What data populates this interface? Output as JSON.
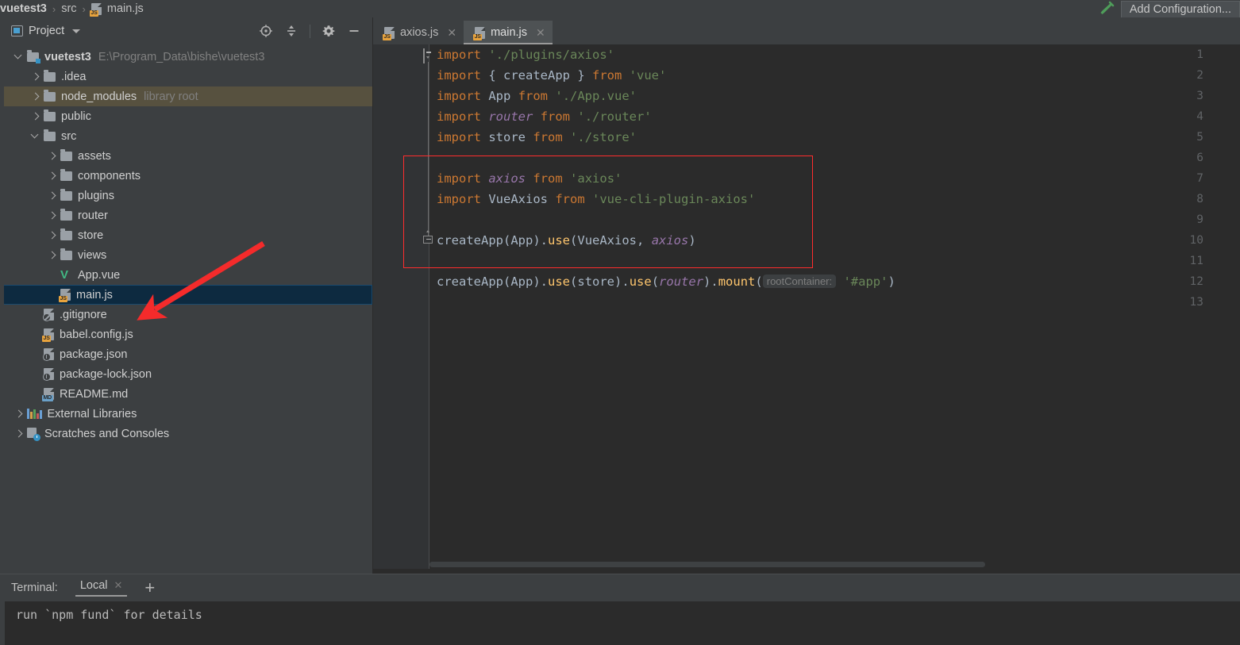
{
  "window": {
    "app": "WebStorm",
    "breadcrumb": [
      {
        "label": "vuetest3",
        "icon": "folder-icon",
        "bold": true
      },
      {
        "label": "src",
        "icon": "folder-icon",
        "bold": false
      },
      {
        "label": "main.js",
        "icon": "js-file-icon",
        "bold": false
      }
    ],
    "breadcrumb_separator": "›",
    "add_configuration_label": "Add Configuration...",
    "build_icon": "hammer-icon"
  },
  "project_panel": {
    "title": "Project",
    "title_icon": "project-view-icon",
    "dropdown_icon": "chevron-down-icon",
    "tools": [
      {
        "name": "locate-icon",
        "tooltip": "Select Opened File"
      },
      {
        "name": "collapse-all-icon",
        "tooltip": "Collapse All"
      },
      {
        "name": "gear-icon",
        "tooltip": "Settings"
      },
      {
        "name": "minimize-icon",
        "tooltip": "Hide"
      }
    ],
    "tree": [
      {
        "label": "vuetest3",
        "sub": "E:\\Program_Data\\bishe\\vuetest3",
        "indent": 0,
        "arrow": "down",
        "icon": "folder-module-icon",
        "bold": true,
        "state": "none"
      },
      {
        "label": ".idea",
        "sub": "",
        "indent": 1,
        "arrow": "right",
        "icon": "folder-icon",
        "bold": false,
        "state": "none"
      },
      {
        "label": "node_modules",
        "sub": "library root",
        "indent": 1,
        "arrow": "right",
        "icon": "folder-icon",
        "bold": false,
        "state": "highlight"
      },
      {
        "label": "public",
        "sub": "",
        "indent": 1,
        "arrow": "right",
        "icon": "folder-icon",
        "bold": false,
        "state": "none"
      },
      {
        "label": "src",
        "sub": "",
        "indent": 1,
        "arrow": "down",
        "icon": "folder-icon",
        "bold": false,
        "state": "none"
      },
      {
        "label": "assets",
        "sub": "",
        "indent": 2,
        "arrow": "right",
        "icon": "folder-icon",
        "bold": false,
        "state": "none"
      },
      {
        "label": "components",
        "sub": "",
        "indent": 2,
        "arrow": "right",
        "icon": "folder-icon",
        "bold": false,
        "state": "none"
      },
      {
        "label": "plugins",
        "sub": "",
        "indent": 2,
        "arrow": "right",
        "icon": "folder-icon",
        "bold": false,
        "state": "none"
      },
      {
        "label": "router",
        "sub": "",
        "indent": 2,
        "arrow": "right",
        "icon": "folder-icon",
        "bold": false,
        "state": "none"
      },
      {
        "label": "store",
        "sub": "",
        "indent": 2,
        "arrow": "right",
        "icon": "folder-icon",
        "bold": false,
        "state": "none"
      },
      {
        "label": "views",
        "sub": "",
        "indent": 2,
        "arrow": "right",
        "icon": "folder-icon",
        "bold": false,
        "state": "none"
      },
      {
        "label": "App.vue",
        "sub": "",
        "indent": 2,
        "arrow": "none",
        "icon": "vue-file-icon",
        "bold": false,
        "state": "none"
      },
      {
        "label": "main.js",
        "sub": "",
        "indent": 2,
        "arrow": "none",
        "icon": "js-file-icon",
        "bold": false,
        "state": "selected"
      },
      {
        "label": ".gitignore",
        "sub": "",
        "indent": 1,
        "arrow": "none",
        "icon": "gitignore-file-icon",
        "bold": false,
        "state": "none"
      },
      {
        "label": "babel.config.js",
        "sub": "",
        "indent": 1,
        "arrow": "none",
        "icon": "js-file-icon",
        "bold": false,
        "state": "none"
      },
      {
        "label": "package.json",
        "sub": "",
        "indent": 1,
        "arrow": "none",
        "icon": "json-file-icon",
        "bold": false,
        "state": "none"
      },
      {
        "label": "package-lock.json",
        "sub": "",
        "indent": 1,
        "arrow": "none",
        "icon": "json-file-icon",
        "bold": false,
        "state": "none"
      },
      {
        "label": "README.md",
        "sub": "",
        "indent": 1,
        "arrow": "none",
        "icon": "md-file-icon",
        "bold": false,
        "state": "none"
      },
      {
        "label": "External Libraries",
        "sub": "",
        "indent": 0,
        "arrow": "right",
        "icon": "external-libraries-icon",
        "bold": false,
        "state": "none"
      },
      {
        "label": "Scratches and Consoles",
        "sub": "",
        "indent": 0,
        "arrow": "right",
        "icon": "scratches-icon",
        "bold": false,
        "state": "none"
      }
    ]
  },
  "editor": {
    "tabs": [
      {
        "label": "axios.js",
        "icon": "js-file-icon",
        "active": false,
        "close_icon": "close-icon"
      },
      {
        "label": "main.js",
        "icon": "js-file-icon",
        "active": true,
        "close_icon": "close-icon"
      }
    ],
    "line_numbers": [
      "1",
      "2",
      "3",
      "4",
      "5",
      "6",
      "7",
      "8",
      "9",
      "10",
      "11",
      "12",
      "13"
    ],
    "code_lines": [
      {
        "n": 1,
        "tokens": [
          {
            "t": "import",
            "c": "kw"
          },
          {
            "t": " ",
            "c": "pn"
          },
          {
            "t": "'./plugins/axios'",
            "c": "str"
          }
        ]
      },
      {
        "n": 2,
        "tokens": [
          {
            "t": "import",
            "c": "kw"
          },
          {
            "t": " { ",
            "c": "pn"
          },
          {
            "t": "createApp",
            "c": "id"
          },
          {
            "t": " } ",
            "c": "pn"
          },
          {
            "t": "from",
            "c": "kw"
          },
          {
            "t": " ",
            "c": "pn"
          },
          {
            "t": "'vue'",
            "c": "str"
          }
        ]
      },
      {
        "n": 3,
        "tokens": [
          {
            "t": "import",
            "c": "kw"
          },
          {
            "t": " ",
            "c": "pn"
          },
          {
            "t": "App",
            "c": "id"
          },
          {
            "t": " ",
            "c": "pn"
          },
          {
            "t": "from",
            "c": "kw"
          },
          {
            "t": " ",
            "c": "pn"
          },
          {
            "t": "'./App.vue'",
            "c": "str"
          }
        ]
      },
      {
        "n": 4,
        "tokens": [
          {
            "t": "import",
            "c": "kw"
          },
          {
            "t": " ",
            "c": "pn"
          },
          {
            "t": "router",
            "c": "glob"
          },
          {
            "t": " ",
            "c": "pn"
          },
          {
            "t": "from",
            "c": "kw"
          },
          {
            "t": " ",
            "c": "pn"
          },
          {
            "t": "'./router'",
            "c": "str"
          }
        ]
      },
      {
        "n": 5,
        "tokens": [
          {
            "t": "import",
            "c": "kw"
          },
          {
            "t": " ",
            "c": "pn"
          },
          {
            "t": "store",
            "c": "id"
          },
          {
            "t": " ",
            "c": "pn"
          },
          {
            "t": "from",
            "c": "kw"
          },
          {
            "t": " ",
            "c": "pn"
          },
          {
            "t": "'./store'",
            "c": "str"
          }
        ]
      },
      {
        "n": 6,
        "tokens": []
      },
      {
        "n": 7,
        "tokens": [
          {
            "t": "import",
            "c": "kw"
          },
          {
            "t": " ",
            "c": "pn"
          },
          {
            "t": "axios",
            "c": "glob"
          },
          {
            "t": " ",
            "c": "pn"
          },
          {
            "t": "from",
            "c": "kw"
          },
          {
            "t": " ",
            "c": "pn"
          },
          {
            "t": "'axios'",
            "c": "str"
          }
        ]
      },
      {
        "n": 8,
        "tokens": [
          {
            "t": "import",
            "c": "kw"
          },
          {
            "t": " ",
            "c": "pn"
          },
          {
            "t": "VueAxios",
            "c": "id"
          },
          {
            "t": " ",
            "c": "pn"
          },
          {
            "t": "from",
            "c": "kw"
          },
          {
            "t": " ",
            "c": "pn"
          },
          {
            "t": "'vue-cli-plugin-axios'",
            "c": "str"
          }
        ]
      },
      {
        "n": 9,
        "tokens": []
      },
      {
        "n": 10,
        "tokens": [
          {
            "t": "createApp",
            "c": "id"
          },
          {
            "t": "(",
            "c": "pn"
          },
          {
            "t": "App",
            "c": "id"
          },
          {
            "t": ").",
            "c": "pn"
          },
          {
            "t": "use",
            "c": "fn"
          },
          {
            "t": "(",
            "c": "pn"
          },
          {
            "t": "VueAxios",
            "c": "id"
          },
          {
            "t": ", ",
            "c": "pn"
          },
          {
            "t": "axios",
            "c": "glob"
          },
          {
            "t": ")",
            "c": "pn"
          }
        ]
      },
      {
        "n": 11,
        "tokens": []
      },
      {
        "n": 12,
        "tokens": [
          {
            "t": "createApp",
            "c": "id"
          },
          {
            "t": "(",
            "c": "pn"
          },
          {
            "t": "App",
            "c": "id"
          },
          {
            "t": ").",
            "c": "pn"
          },
          {
            "t": "use",
            "c": "fn"
          },
          {
            "t": "(",
            "c": "pn"
          },
          {
            "t": "store",
            "c": "id"
          },
          {
            "t": ").",
            "c": "pn"
          },
          {
            "t": "use",
            "c": "fn"
          },
          {
            "t": "(",
            "c": "pn"
          },
          {
            "t": "router",
            "c": "glob"
          },
          {
            "t": ").",
            "c": "pn"
          },
          {
            "t": "mount",
            "c": "fn"
          },
          {
            "t": "(",
            "c": "pn"
          },
          {
            "t": "rootContainer:",
            "c": "hint"
          },
          {
            "t": " ",
            "c": "pn"
          },
          {
            "t": "'#app'",
            "c": "str"
          },
          {
            "t": ")",
            "c": "pn"
          }
        ]
      },
      {
        "n": 13,
        "tokens": []
      }
    ],
    "inlay_hint": "rootContainer:",
    "fold_markers": [
      {
        "line": 1,
        "type": "start"
      },
      {
        "line": 8,
        "type": "end"
      }
    ]
  },
  "annotations": {
    "highlight_box": {
      "color": "#ff2d2d",
      "from_line": 6,
      "to_line": 11
    },
    "arrow": {
      "color": "#f42b2b",
      "points_to": "main.js"
    }
  },
  "terminal": {
    "label": "Terminal:",
    "tabs": [
      {
        "label": "Local",
        "active": true,
        "close_icon": "close-icon"
      }
    ],
    "add_icon": "plus-icon",
    "output": [
      "run `npm fund` for details"
    ]
  },
  "colors": {
    "panel_bg": "#3c3f41",
    "editor_bg": "#2b2b2b",
    "gutter_bg": "#313335",
    "keyword": "#cc7832",
    "string": "#6a8759",
    "identifier": "#a9b7c6",
    "global_var": "#9876aa",
    "function": "#ffc66d",
    "selection": "#0d2a40",
    "library_root": "#57513f",
    "annotation_red": "#ff2d2d"
  }
}
